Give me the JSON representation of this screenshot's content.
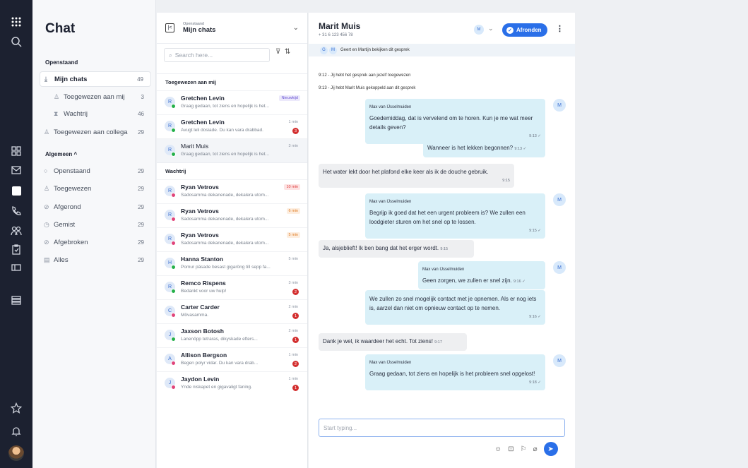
{
  "nav": {
    "chat_title": "Chat",
    "sec_open": "Openstaand",
    "sec_general": "Algemeen ^",
    "items_open": [
      {
        "label": "Mijn chats",
        "count": "49"
      },
      {
        "label": "Toegewezen aan mij",
        "count": "3"
      },
      {
        "label": "Wachtrij",
        "count": "46"
      },
      {
        "label": "Toegewezen aan collega",
        "count": "29"
      }
    ],
    "items_general": [
      {
        "label": "Openstaand",
        "count": "29"
      },
      {
        "label": "Toegewezen",
        "count": "29"
      },
      {
        "label": "Afgerond",
        "count": "29"
      },
      {
        "label": "Gemist",
        "count": "29"
      },
      {
        "label": "Afgebroken",
        "count": "29"
      },
      {
        "label": "Alles",
        "count": "29"
      }
    ]
  },
  "list": {
    "header_small": "Openstaand",
    "header_title": "Mijn chats",
    "search_placeholder": "Search here...",
    "grp_assigned": "Toegewezen aan mij",
    "grp_queue": "Wachtrij",
    "assigned": [
      {
        "initial": "R",
        "name": "Gretchen Levin",
        "preview": "Graag gedaan, tot ziens en hopelijk is het...",
        "tag": "Nieuwkijd"
      },
      {
        "initial": "R",
        "name": "Gretchen Levin",
        "preview": "Avugt leli dosiade. Du kan vara drabbad.",
        "tag": "1 min",
        "badge": "3"
      },
      {
        "initial": "R",
        "name": "Marit Muis",
        "preview": "Graag gedaan, tot ziens en hopelijk is het...",
        "tag": "3 min"
      }
    ],
    "queue": [
      {
        "initial": "R",
        "name": "Ryan Vetrovs",
        "preview": "Sadosamma dekanenade, dekalera utom...",
        "tag": "10 min"
      },
      {
        "initial": "R",
        "name": "Ryan Vetrovs",
        "preview": "Sadosamma dekanenade, dekalera utom...",
        "tag": "6 min"
      },
      {
        "initial": "R",
        "name": "Ryan Vetrovs",
        "preview": "Sadosamma dekanenade, dekalera utom...",
        "tag": "5 min"
      },
      {
        "initial": "H",
        "name": "Hanna Stanton",
        "preview": "Pomur päsade besast gigaröng till sepp fa...",
        "tag": "5 min"
      },
      {
        "initial": "R",
        "name": "Remco Rispens",
        "preview": "Bedankt voor uw hulp!",
        "tag": "3 min",
        "badge": "2"
      },
      {
        "initial": "C",
        "name": "Carter Carder",
        "preview": "Mövasamma.",
        "tag": "2 min",
        "badge": "1"
      },
      {
        "initial": "J",
        "name": "Jaxson Botosh",
        "preview": "Lanenöpp tetraras, dikyskade efters...",
        "tag": "2 min",
        "badge": "1"
      },
      {
        "initial": "A",
        "name": "Allison Bergson",
        "preview": "Begen polyr vidar. Du kan vara drab...",
        "tag": "1 min",
        "badge": "2"
      },
      {
        "initial": "J",
        "name": "Jaydon Levin",
        "preview": "Ynde niskapet en gigavaligt faning.",
        "tag": "1 min",
        "badge": "1"
      }
    ]
  },
  "chat": {
    "name": "Marit Muis",
    "phone": "+ 31 6 123 456 78",
    "avatar": "M",
    "finish": "Afronden",
    "watching": "Geert en Martijn bekijken dit gesprek",
    "watch_a": "G",
    "watch_b": "M",
    "sys1": "9:12 - Jij hebt het gesprek aan jezelf toegewezen",
    "sys2": "9:13 - Jij hebt Marit Muis gekoppeld aan dit gesprek",
    "m1_sender": "Max van IJsselmuiden",
    "m1_text": "Goedemiddag, dat is vervelend om te horen. Kun je me wat meer details geven?",
    "m1_time": "9:13 ✓",
    "m2_text": "Wanneer is het lekken begonnen?",
    "m2_time": "9:13 ✓",
    "m3_text": "Het water lekt door het plafond elke keer als ik de douche gebruik.",
    "m3_time": "9:15",
    "m4_sender": "Max van IJsselmuiden",
    "m4_text": "Begrijp ik goed dat het een urgent probleem is? We zullen een loodgieter sturen om het snel op te lossen.",
    "m4_time": "9:15 ✓",
    "m5_text": "Ja, alsjeblieft! Ik ben bang dat het erger wordt.",
    "m5_time": "9:15",
    "m6_sender": "Max van IJsselmuiden",
    "m6_text": "Geen zorgen, we zullen er snel zijn.",
    "m6_time": "9:16 ✓",
    "m7_text": "We zullen zo snel mogelijk contact met je opnemen. Als er nog iets is, aarzel dan niet om opnieuw contact op te nemen.",
    "m7_time": "9:16 ✓",
    "m8_text": "Dank je wel, ik waardeer het echt. Tot ziens!",
    "m8_time": "9:17",
    "m9_sender": "Max van IJsselmuiden",
    "m9_text": "Graag gedaan, tot ziens en hopelijk is het probleem snel opgelost!",
    "m9_time": "9:18 ✓",
    "input_placeholder": "Start typing..."
  }
}
